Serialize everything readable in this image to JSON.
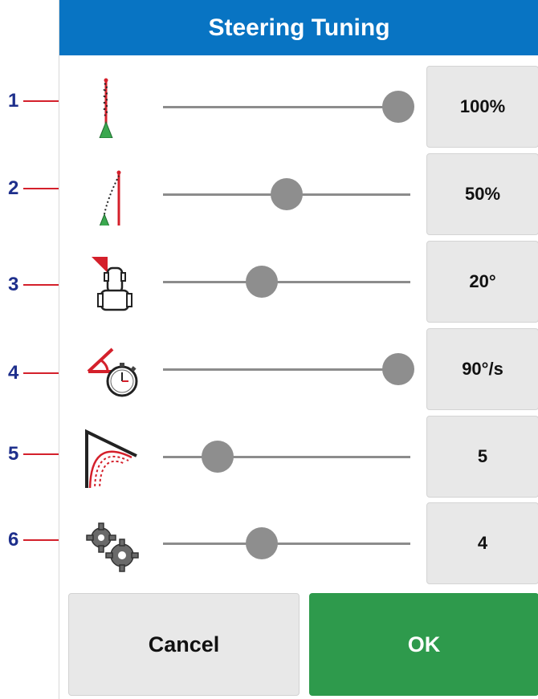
{
  "dialog": {
    "title": "Steering Tuning"
  },
  "callouts": [
    "1",
    "2",
    "3",
    "4",
    "5",
    "6"
  ],
  "rows": [
    {
      "value": "100%",
      "slider_fraction": 0.95
    },
    {
      "value": "50%",
      "slider_fraction": 0.5
    },
    {
      "value": "20°",
      "slider_fraction": 0.4
    },
    {
      "value": "90°/s",
      "slider_fraction": 0.95
    },
    {
      "value": "5",
      "slider_fraction": 0.22
    },
    {
      "value": "4",
      "slider_fraction": 0.4
    }
  ],
  "buttons": {
    "cancel": "Cancel",
    "ok": "OK"
  },
  "icons": [
    "online-aggressiveness-icon",
    "approach-aggressiveness-icon",
    "lookahead-tractor-icon",
    "turn-rate-timer-icon",
    "turn-curve-icon",
    "gears-icon"
  ],
  "colors": {
    "title_bar": "#0874c3",
    "ok_button": "#2e9a4c",
    "callout_text": "#1e2f8c",
    "callout_line": "#d4202b"
  }
}
